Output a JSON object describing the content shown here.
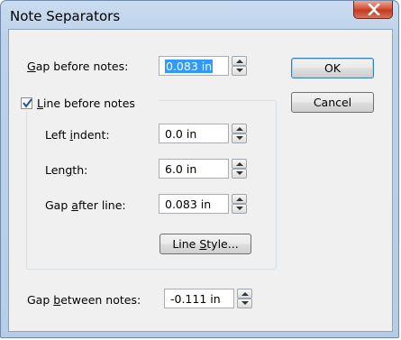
{
  "window": {
    "title": "Note Separators",
    "close_glyph": "X"
  },
  "fields": {
    "gap_before_notes": {
      "label_pre": "",
      "label_key": "G",
      "label_post": "ap before notes:",
      "value": "0.083 in"
    },
    "line_before_notes": {
      "label_pre": "",
      "label_key": "L",
      "label_post": "ine before notes",
      "checked": true
    },
    "left_indent": {
      "label_pre": "Left ",
      "label_key": "i",
      "label_post": "ndent:",
      "value": "0.0 in"
    },
    "length": {
      "label_pre": "Len",
      "label_key": "g",
      "label_post": "th:",
      "value": "6.0 in"
    },
    "gap_after_line": {
      "label_pre": "Gap ",
      "label_key": "a",
      "label_post": "fter line:",
      "value": "0.083 in"
    },
    "gap_between_notes": {
      "label_pre": "Gap ",
      "label_key": "b",
      "label_post": "etween notes:",
      "value": "-0.111 in"
    }
  },
  "buttons": {
    "ok": "OK",
    "cancel": "Cancel",
    "line_style_pre": "Line ",
    "line_style_key": "S",
    "line_style_post": "tyle..."
  },
  "colors": {
    "selection": "#3399ff",
    "close_button": "#c33a20",
    "title_bar": "#bcd2ea"
  }
}
